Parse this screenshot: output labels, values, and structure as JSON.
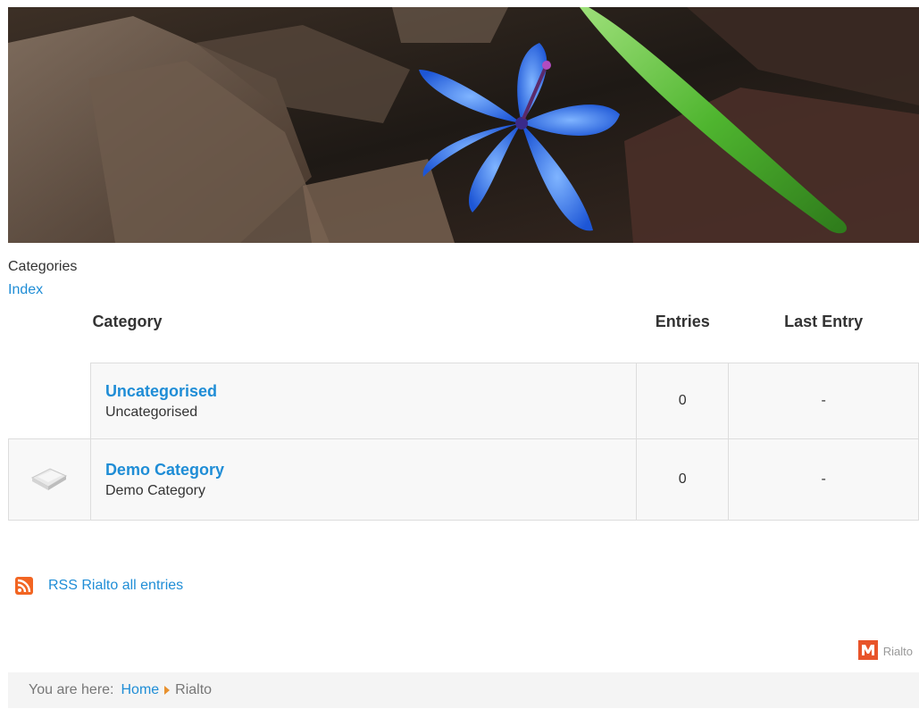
{
  "header": {
    "banner_alt": "Blue flower among dry leaves"
  },
  "section": {
    "heading": "Categories",
    "index_link": "Index"
  },
  "table": {
    "headers": {
      "category": "Category",
      "entries": "Entries",
      "last_entry": "Last Entry"
    },
    "rows": [
      {
        "name": "Uncategorised",
        "description": "Uncategorised",
        "entries": "0",
        "last_entry": "-"
      },
      {
        "name": "Demo Category",
        "description": "Demo Category",
        "entries": "0",
        "last_entry": "-",
        "icon": "folder-icon"
      }
    ]
  },
  "rss": {
    "label": "RSS Rialto all entries",
    "icon": "rss-icon"
  },
  "powered": {
    "label": "Rialto",
    "icon": "m-logo-icon"
  },
  "breadcrumb": {
    "label": "You are here:",
    "items": [
      "Home",
      "Rialto"
    ]
  },
  "colors": {
    "link": "#1f8dd6",
    "rss": "#f26522",
    "breadcrumb_arrow": "#e8912f"
  }
}
